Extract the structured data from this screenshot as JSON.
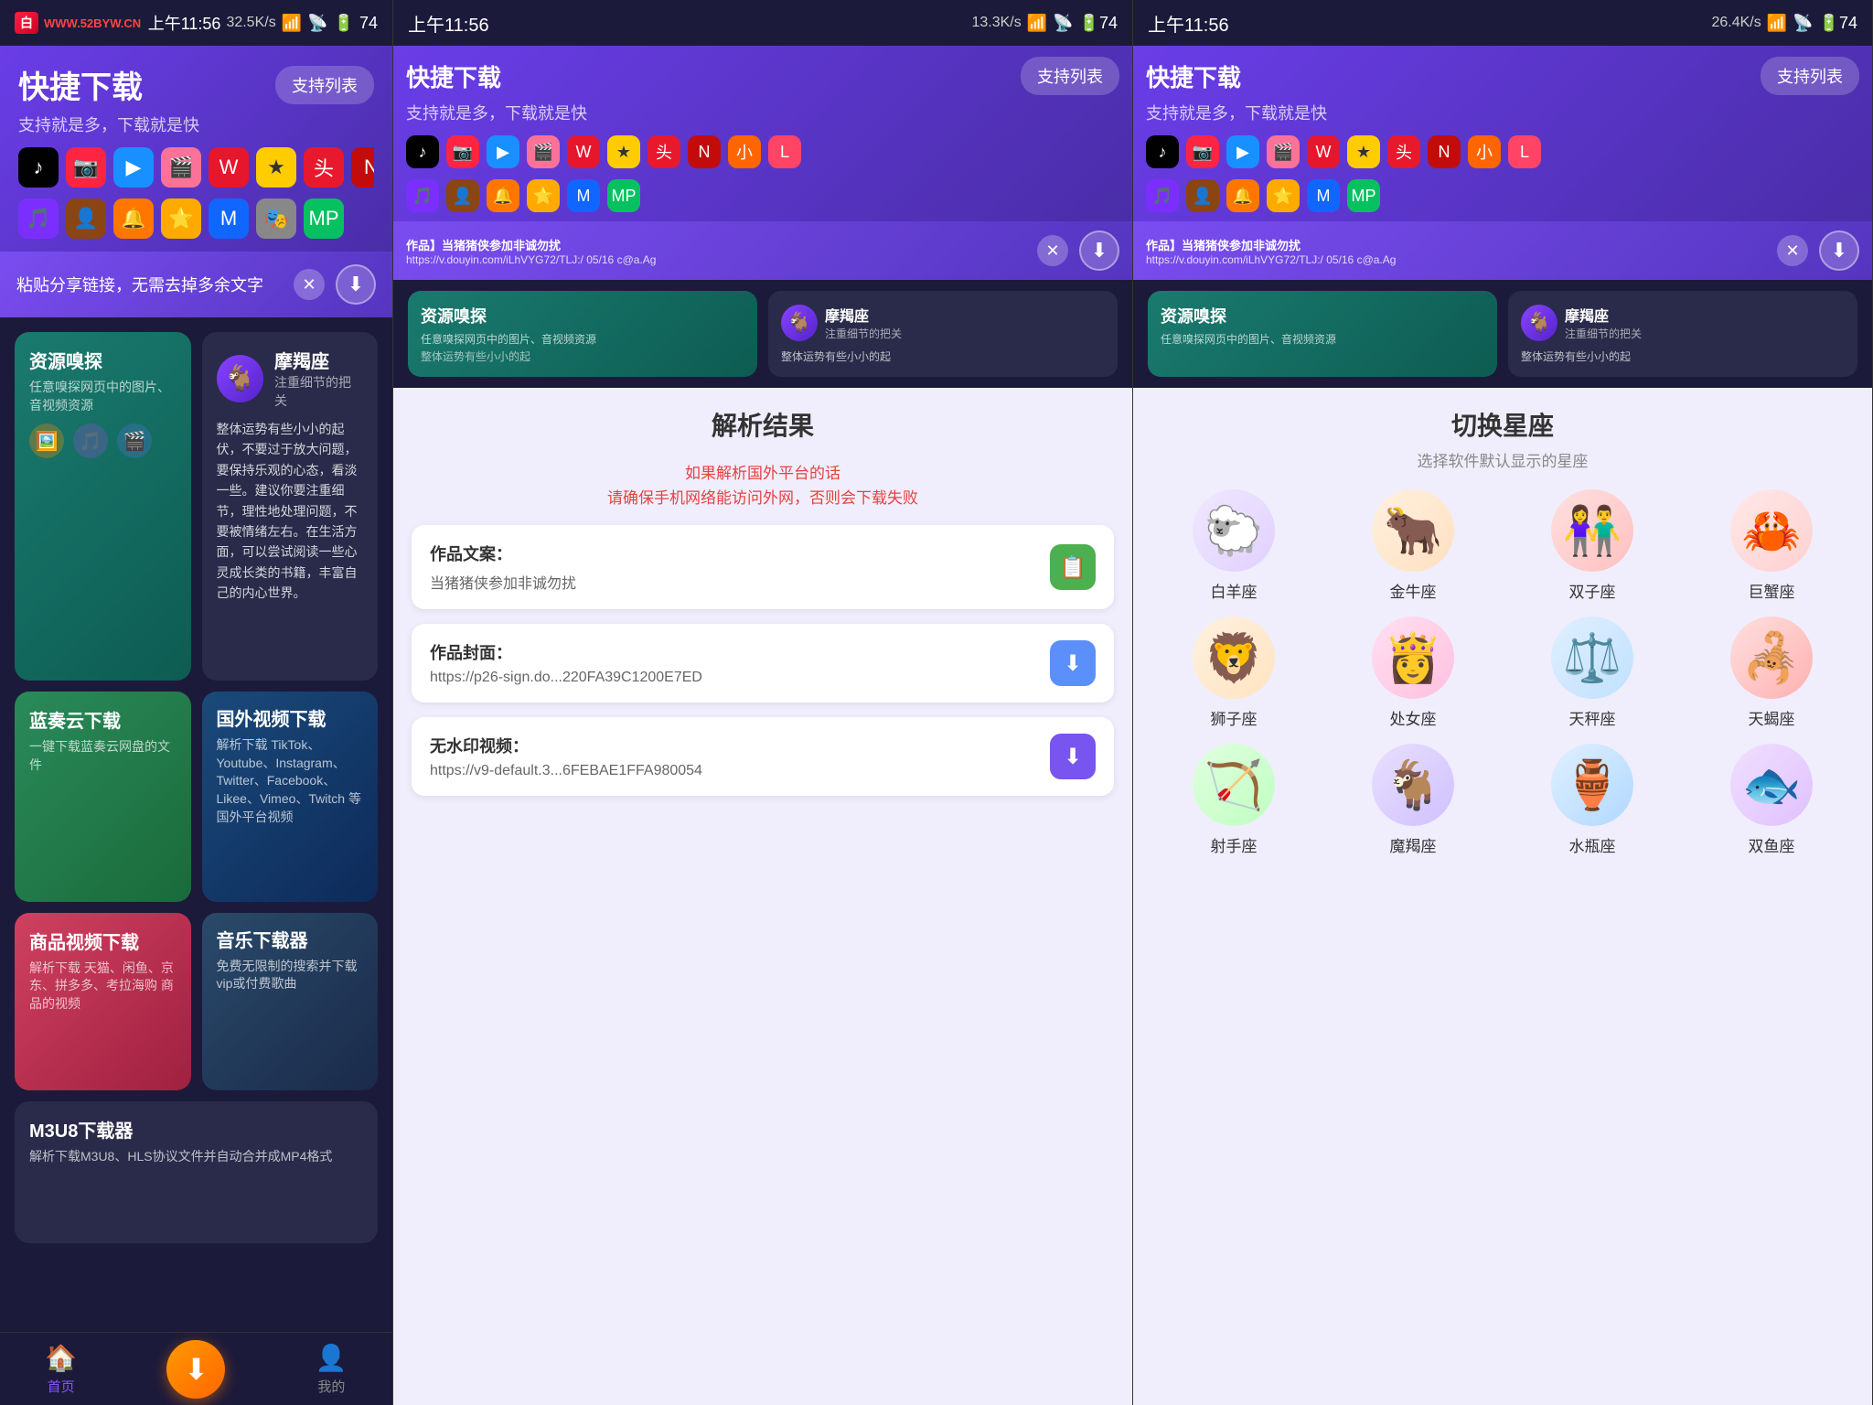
{
  "panels": [
    {
      "id": "left",
      "statusBar": {
        "time": "上午11:56",
        "network": "32.5K/s",
        "battery": "74"
      },
      "header": {
        "title": "快捷下载",
        "subtitle": "支持就是多，下载就是快",
        "supportBtn": "支持列表"
      },
      "pasteArea": {
        "text": "粘贴分享链接，无需去掉多余文字"
      },
      "appIcons": [
        {
          "emoji": "♪",
          "class": "ic-tiktok"
        },
        {
          "emoji": "📷",
          "class": "ic-red"
        },
        {
          "emoji": "▶",
          "class": "ic-youku"
        },
        {
          "emoji": "🎬",
          "class": "ic-bilibili"
        },
        {
          "emoji": "W",
          "class": "ic-weibo"
        },
        {
          "emoji": "★",
          "class": "ic-yellow"
        },
        {
          "emoji": "头",
          "class": "ic-toutiao"
        },
        {
          "emoji": "N",
          "class": "ic-netease"
        },
        {
          "emoji": "小",
          "class": "ic-kuaishou"
        },
        {
          "emoji": "L",
          "class": "ic-lala"
        }
      ],
      "appIcons2": [
        {
          "emoji": "🎵",
          "class": "ic-purple2"
        },
        {
          "emoji": "👤",
          "class": "ic-brown"
        },
        {
          "emoji": "🔔",
          "class": "ic-orange2"
        },
        {
          "emoji": "⭐",
          "class": "ic-star"
        },
        {
          "emoji": "M",
          "class": "ic-blue2"
        },
        {
          "emoji": "🎭",
          "class": "ic-gray"
        },
        {
          "emoji": "MP",
          "class": "ic-mp"
        }
      ],
      "featureCards": [
        {
          "id": "resource",
          "title": "资源嗅探",
          "desc": "任意嗅探网页中的图片、音视频资源",
          "class": "teal",
          "icons": [
            "🖼️",
            "🎵",
            "🎬"
          ]
        },
        {
          "id": "baiyun",
          "title": "蓝奏云下载",
          "desc": "一键下载蓝奏云网盘的文件",
          "class": "green"
        },
        {
          "id": "product",
          "title": "商品视频下载",
          "desc": "解析下载 天猫、闲鱼、京东、拼多多、考拉海购 商品的视频",
          "class": "pink"
        },
        {
          "id": "m3u8",
          "title": "M3U8下载器",
          "desc": "解析下载M3U8、HLS协议文件并自动合并成MP4格式",
          "class": "purple-dark"
        }
      ],
      "horoscope": {
        "name": "摩羯座",
        "sub": "注重细节的把关",
        "text": "整体运势有些小小的起伏，不要过于放大问题，要保持乐观的心态，看淡一些。建议你要注重细节，理性地处理问题，不要被情绪左右。在生活方面，可以尝试阅读一些心灵成长类的书籍，丰富自己的内心世界。"
      },
      "foreignDownload": {
        "title": "国外视频下载",
        "desc": "解析下载 TikTok、Youtube、Instagram、Twitter、Facebook、Likee、Vimeo、Twitch 等国外平台视频"
      },
      "musicDownload": {
        "title": "音乐下载器",
        "desc": "免费无限制的搜索并下载vip或付费歌曲"
      },
      "nav": {
        "home": "首页",
        "mine": "我的"
      }
    }
  ],
  "middlePanel": {
    "statusBar": {
      "time": "上午11:56",
      "network": "13.3K/s"
    },
    "header": {
      "title": "快捷下载",
      "subtitle": "支持就是多，下载就是快",
      "supportBtn": "支持列表"
    },
    "pasteContent": {
      "title": "作品】当猪猪侠参加非诚勿扰",
      "url": "https://v.douyin.com/iLhVYG72/TLJ:/ 05/16 c@a.Ag"
    },
    "parseResult": {
      "title": "解析结果",
      "warning1": "如果解析国外平台的话",
      "warning2": "请确保手机网络能访问外网，否则会下载失败",
      "fields": [
        {
          "label": "作品文案：",
          "value": "当猪猪侠参加非诚勿扰",
          "actionType": "copy",
          "btnColor": "green"
        },
        {
          "label": "作品封面：",
          "value": "https://p26-sign.do...220FA39C1200E7ED",
          "actionType": "download",
          "btnColor": "blue"
        },
        {
          "label": "无水印视频：",
          "value": "https://v9-default.3...6FEBAE1FFA980054",
          "actionType": "download",
          "btnColor": "purple"
        }
      ]
    }
  },
  "rightPanel": {
    "statusBar": {
      "time": "上午11:56",
      "network": "26.4K/s"
    },
    "header": {
      "title": "快捷下载",
      "subtitle": "支持就是多，下载就是快",
      "supportBtn": "支持列表"
    },
    "pasteContent": {
      "title": "作品】当猪猪侠参加非诚勿扰",
      "url": "https://v.douyin.com/iLhVYG72/TLJ:/ 05/16 c@a.Ag"
    },
    "zodiac": {
      "title": "切换星座",
      "subtitle": "选择软件默认显示的星座",
      "items": [
        {
          "name": "白羊座",
          "emoji": "🐑",
          "class": "z-aries"
        },
        {
          "name": "金牛座",
          "emoji": "🐂",
          "class": "z-taurus"
        },
        {
          "name": "双子座",
          "emoji": "👫",
          "class": "z-gemini"
        },
        {
          "name": "巨蟹座",
          "emoji": "🦀",
          "class": "z-cancer"
        },
        {
          "name": "狮子座",
          "emoji": "🦁",
          "class": "z-leo"
        },
        {
          "name": "处女座",
          "emoji": "👸",
          "class": "z-virgo"
        },
        {
          "name": "天秤座",
          "emoji": "⚖️",
          "class": "z-libra"
        },
        {
          "name": "天蝎座",
          "emoji": "🦂",
          "class": "z-scorpio"
        },
        {
          "name": "射手座",
          "emoji": "🏹",
          "class": "z-sagittarius"
        },
        {
          "name": "魔羯座",
          "emoji": "🐐",
          "class": "z-capricorn"
        },
        {
          "name": "水瓶座",
          "emoji": "🏺",
          "class": "z-aquarius"
        },
        {
          "name": "双鱼座",
          "emoji": "🐟",
          "class": "z-pisces"
        }
      ]
    }
  },
  "icons": {
    "home": "🏠",
    "download": "⬇",
    "user": "👤",
    "close": "✕",
    "copy": "📋",
    "search": "🔍"
  }
}
